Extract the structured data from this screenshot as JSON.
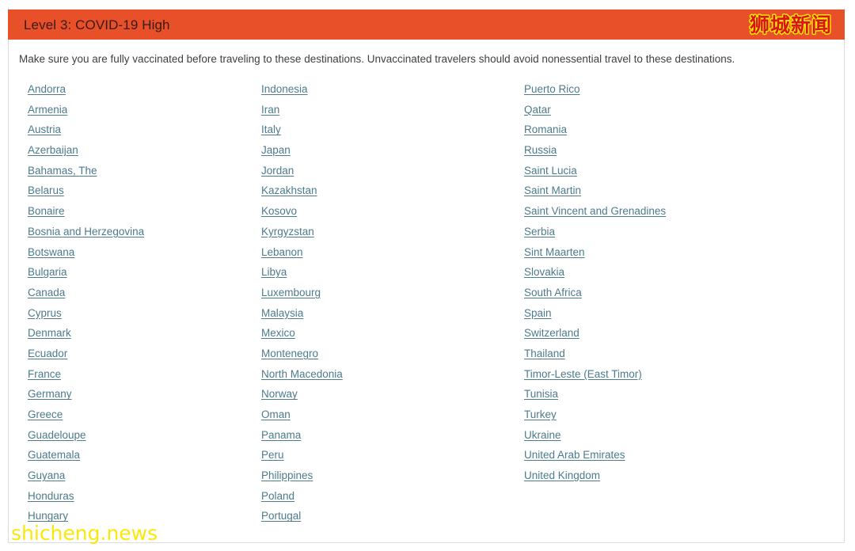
{
  "banner": {
    "title": "Level 3: COVID-19 High",
    "background_color": "#e8502a",
    "title_color": "#3b1a14",
    "brand_watermark": "狮城新闻",
    "brand_watermark_color": "#d8161a",
    "brand_watermark_outline_color": "#ffe600"
  },
  "intro": {
    "text": "Make sure you are fully vaccinated before traveling to these destinations. Unvaccinated travelers should avoid nonessential travel to these destinations."
  },
  "destinations": {
    "link_color": "#4c7b8b",
    "columns": [
      {
        "name": "column-1",
        "items": [
          "Andorra",
          "Armenia",
          "Austria",
          "Azerbaijan",
          "Bahamas, The",
          "Belarus",
          "Bonaire",
          "Bosnia and Herzegovina",
          "Botswana",
          "Bulgaria",
          "Canada",
          "Cyprus",
          "Denmark",
          "Ecuador",
          "France",
          "Germany",
          "Greece",
          "Guadeloupe",
          "Guatemala",
          "Guyana",
          "Honduras",
          "Hungary"
        ]
      },
      {
        "name": "column-2",
        "items": [
          "Indonesia",
          "Iran",
          "Italy",
          "Japan",
          "Jordan",
          "Kazakhstan",
          "Kosovo",
          "Kyrgyzstan",
          "Lebanon",
          "Libya",
          "Luxembourg",
          "Malaysia",
          "Mexico",
          "Montenegro",
          "North Macedonia",
          "Norway",
          "Oman",
          "Panama",
          "Peru",
          "Philippines",
          "Poland",
          "Portugal"
        ]
      },
      {
        "name": "column-3",
        "items": [
          "Puerto Rico",
          "Qatar",
          "Romania",
          "Russia",
          "Saint Lucia",
          "Saint Martin",
          "Saint Vincent and Grenadines",
          "Serbia",
          "Sint Maarten",
          "Slovakia",
          "South Africa",
          "Spain",
          "Switzerland",
          "Thailand",
          "Timor-Leste (East Timor)",
          "Tunisia",
          "Turkey",
          "Ukraine",
          "United Arab Emirates",
          "United Kingdom"
        ]
      }
    ]
  },
  "footer": {
    "site_watermark": "shicheng.news",
    "site_watermark_color": "#fbe70a",
    "site_watermark_outline_color": "#ffffff"
  }
}
